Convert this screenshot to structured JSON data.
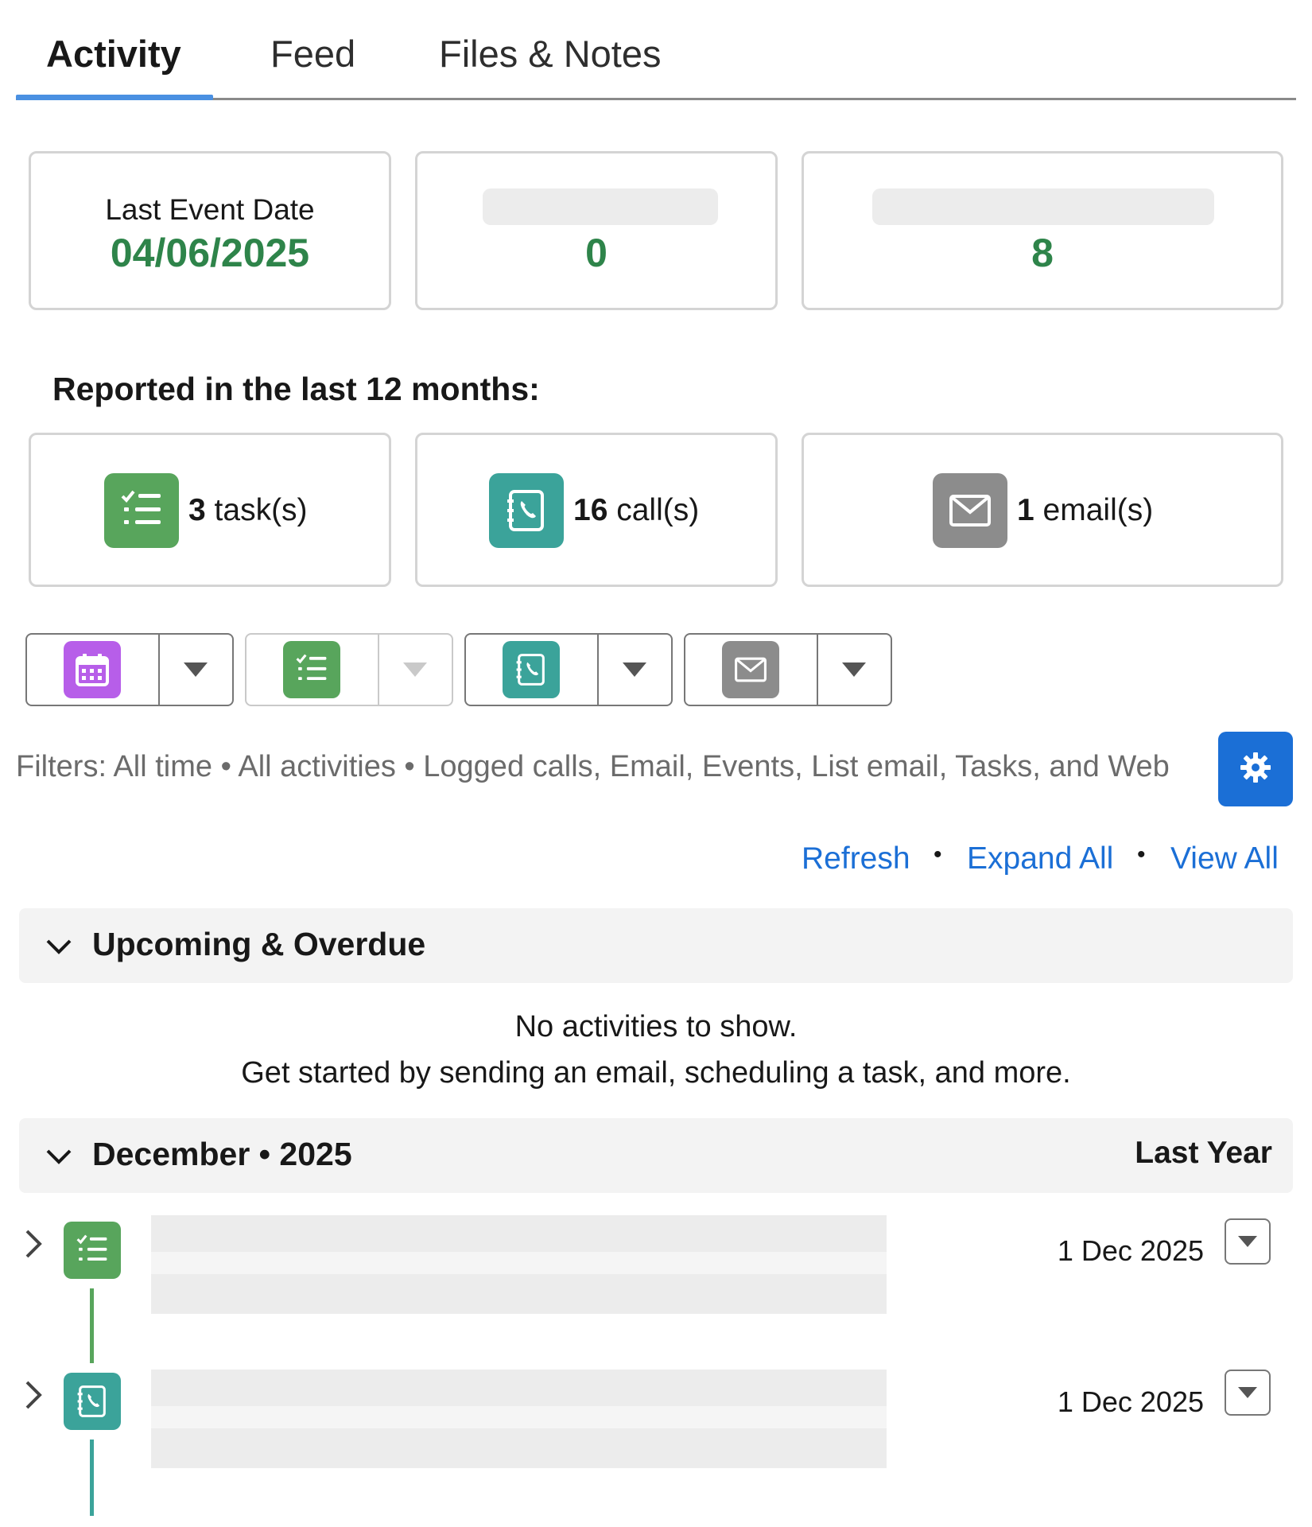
{
  "tabs": [
    {
      "label": "Activity",
      "active": true
    },
    {
      "label": "Feed",
      "active": false
    },
    {
      "label": "Files & Notes",
      "active": false
    }
  ],
  "summary": {
    "last_event": {
      "label": "Last Event Date",
      "value": "04/06/2025"
    },
    "metric2": {
      "value": "0"
    },
    "metric3": {
      "value": "8"
    }
  },
  "reported": {
    "title": "Reported in the last 12 months:",
    "tasks": {
      "count": "3",
      "unit": "task(s)",
      "icon": "task-icon"
    },
    "calls": {
      "count": "16",
      "unit": "call(s)",
      "icon": "call-icon"
    },
    "emails": {
      "count": "1",
      "unit": "email(s)",
      "icon": "email-icon"
    }
  },
  "actions": [
    {
      "icon": "event-icon"
    },
    {
      "icon": "task-icon"
    },
    {
      "icon": "call-icon"
    },
    {
      "icon": "email-icon"
    }
  ],
  "filters": {
    "text": "Filters: All time • All activities • Logged calls, Email, Events, List email, Tasks, and Web"
  },
  "links": {
    "refresh": "Refresh",
    "expand_all": "Expand All",
    "view_all": "View All",
    "separator": "•"
  },
  "upcoming": {
    "title": "Upcoming & Overdue",
    "empty_line1": "No activities to show.",
    "empty_line2": "Get started by sending an email, scheduling a task, and more."
  },
  "month_group": {
    "title": "December • 2025",
    "right_label": "Last Year",
    "items": [
      {
        "type": "task",
        "date": "1 Dec 2025"
      },
      {
        "type": "call",
        "date": "1 Dec 2025"
      }
    ]
  },
  "colors": {
    "accent_blue": "#1b6fd6",
    "tab_underline": "#4a90e2",
    "value_green": "#2e844a",
    "task_green": "#58a55c",
    "call_teal": "#3ba39a",
    "email_gray": "#8c8c8c",
    "event_purple": "#b75ee9"
  }
}
